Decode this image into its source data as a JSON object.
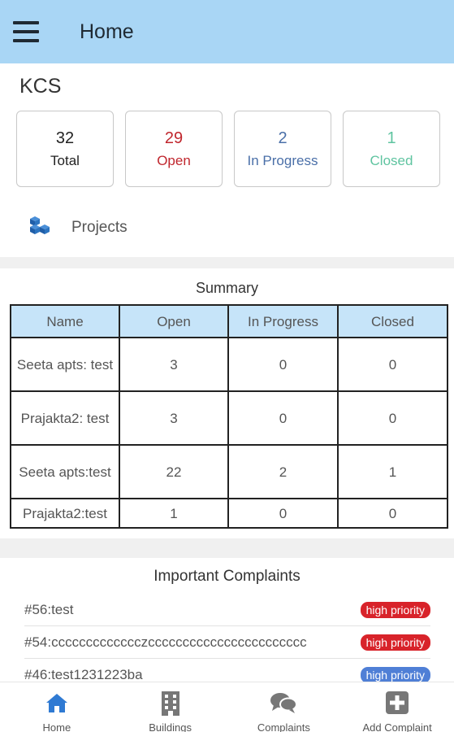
{
  "appbar": {
    "title": "Home"
  },
  "org": {
    "name": "KCS"
  },
  "stats": [
    {
      "value": "32",
      "label": "Total",
      "color": "#222222"
    },
    {
      "value": "29",
      "label": "Open",
      "color": "#c0262d"
    },
    {
      "value": "2",
      "label": "In Progress",
      "color": "#4a6fa8"
    },
    {
      "value": "1",
      "label": "Closed",
      "color": "#5fc4a0"
    }
  ],
  "projects": {
    "label": "Projects",
    "icon": "projects-icon"
  },
  "summary": {
    "title": "Summary",
    "headers": [
      "Name",
      "Open",
      "In Progress",
      "Closed"
    ],
    "rows": [
      [
        "Seeta apts: test",
        "3",
        "0",
        "0"
      ],
      [
        "Prajakta2: test",
        "3",
        "0",
        "0"
      ],
      [
        "Seeta apts:test",
        "22",
        "2",
        "1"
      ],
      [
        "Prajakta2:test",
        "1",
        "0",
        "0"
      ]
    ]
  },
  "important_complaints": {
    "title": "Important Complaints",
    "items": [
      {
        "text": "#56:test",
        "priority": "high priority",
        "color": "#d8232a"
      },
      {
        "text": "#54:ccccccccccccczccccccccccccccccccccccc",
        "priority": "high priority",
        "color": "#d8232a"
      },
      {
        "text": "#46:test1231223ba",
        "priority": "high priority",
        "color": "#4f7fd6"
      }
    ]
  },
  "bottom_nav": [
    {
      "label": "Home",
      "icon": "home-icon",
      "active": true
    },
    {
      "label": "Buildings",
      "icon": "building-icon",
      "active": false
    },
    {
      "label": "Complaints",
      "icon": "chat-icon",
      "active": false
    },
    {
      "label": "Add Complaint",
      "icon": "plus-square-icon",
      "active": false
    }
  ],
  "colors": {
    "appbar": "#a9d6f5",
    "table_header": "#c6e4f9",
    "nav_active": "#2f7ad3",
    "nav_inactive": "#777777"
  }
}
